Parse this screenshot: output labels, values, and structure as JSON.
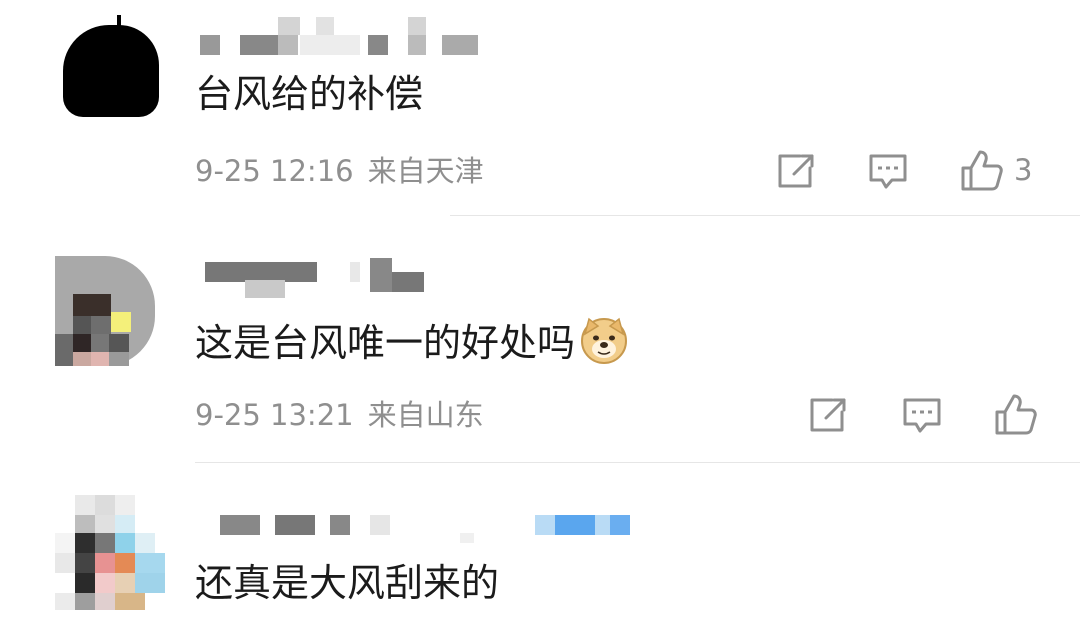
{
  "comments": [
    {
      "text": "台风给的补偿",
      "date": "9-25 12:16",
      "location": "来自天津",
      "like_count": "3"
    },
    {
      "text": "这是台风唯一的好处吗",
      "emoji": "doge-emoji",
      "date": "9-25 13:21",
      "location": "来自山东",
      "like_count": ""
    },
    {
      "text": "还真是大风刮来的"
    }
  ],
  "icons": {
    "share": "share-icon",
    "comment": "comment-icon",
    "like": "thumbs-up-icon"
  },
  "colors": {
    "text": "#1b1b1b",
    "meta": "#8f8f8f",
    "divider": "#e6e6e6"
  }
}
